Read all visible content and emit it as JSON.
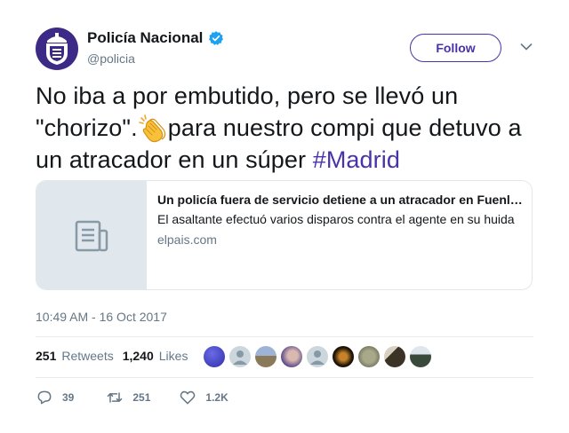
{
  "author": {
    "name": "Policía Nacional",
    "handle": "@policia",
    "verified": true,
    "avatar_icon": "police-badge-icon"
  },
  "follow_label": "Follow",
  "tweet": {
    "text_part1": "No iba a por embutido, pero se llevó un \"chorizo\".",
    "emoji": "clapping-hands-icon",
    "text_part2": "para nuestro compi que detuvo a un atracador en un súper ",
    "hashtag": "#Madrid"
  },
  "card": {
    "title": "Un policía fuera de servicio detiene a un atracador en Fuenlabrada",
    "description": "El asaltante efectuó varios disparos contra el agente en su huida",
    "domain": "elpais.com",
    "thumb_icon": "document-icon"
  },
  "timestamp": "10:49 AM - 16 Oct 2017",
  "stats": {
    "retweets_count": "251",
    "retweets_label": "Retweets",
    "likes_count": "1,240",
    "likes_label": "Likes"
  },
  "actions": {
    "reply_count": "39",
    "retweet_count": "251",
    "like_count": "1.2K"
  },
  "colors": {
    "brand": "#4a32a8",
    "verified": "#1da1f2",
    "muted": "#657786"
  }
}
